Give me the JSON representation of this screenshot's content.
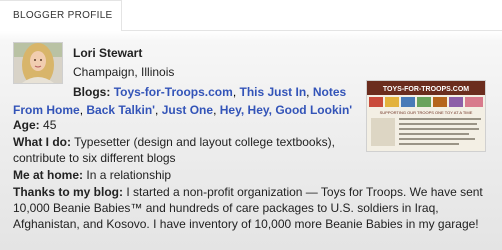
{
  "widget": {
    "tab_label": "BLOGGER PROFILE"
  },
  "profile": {
    "name": "Lori Stewart",
    "location": "Champaign, Illinois",
    "blogs_label": "Blogs:",
    "blogs": [
      "Toys-for-Troops.com",
      "This Just In",
      "Notes From Home",
      "Back Talkin'",
      "Just One",
      "Hey, Hey, Good Lookin'"
    ],
    "age_label": "Age:",
    "age": "45",
    "what_i_do_label": "What I do:",
    "what_i_do": "Typesetter (design and layout college textbooks), contribute to six different blogs",
    "me_at_home_label": "Me at home:",
    "me_at_home": "In a relationship",
    "thanks_label": "Thanks to my blog:",
    "thanks": "I started a non-profit organization — Toys for Troops. We have sent 10,000 Beanie Babies™ and hundreds of care packages to U.S. soldiers in Iraq, Afghanistan, and Kosovo. I have inventory of 10,000 more Beanie Babies in my garage!"
  },
  "thumbnail": {
    "site_title": "TOYS-FOR-TROOPS.COM",
    "banner_text": "SUPPORTING OUR TROOPS ONE TOY AT A TIME"
  },
  "colors": {
    "link": "#3354b8",
    "thumb_header": "#6b2d1e"
  }
}
